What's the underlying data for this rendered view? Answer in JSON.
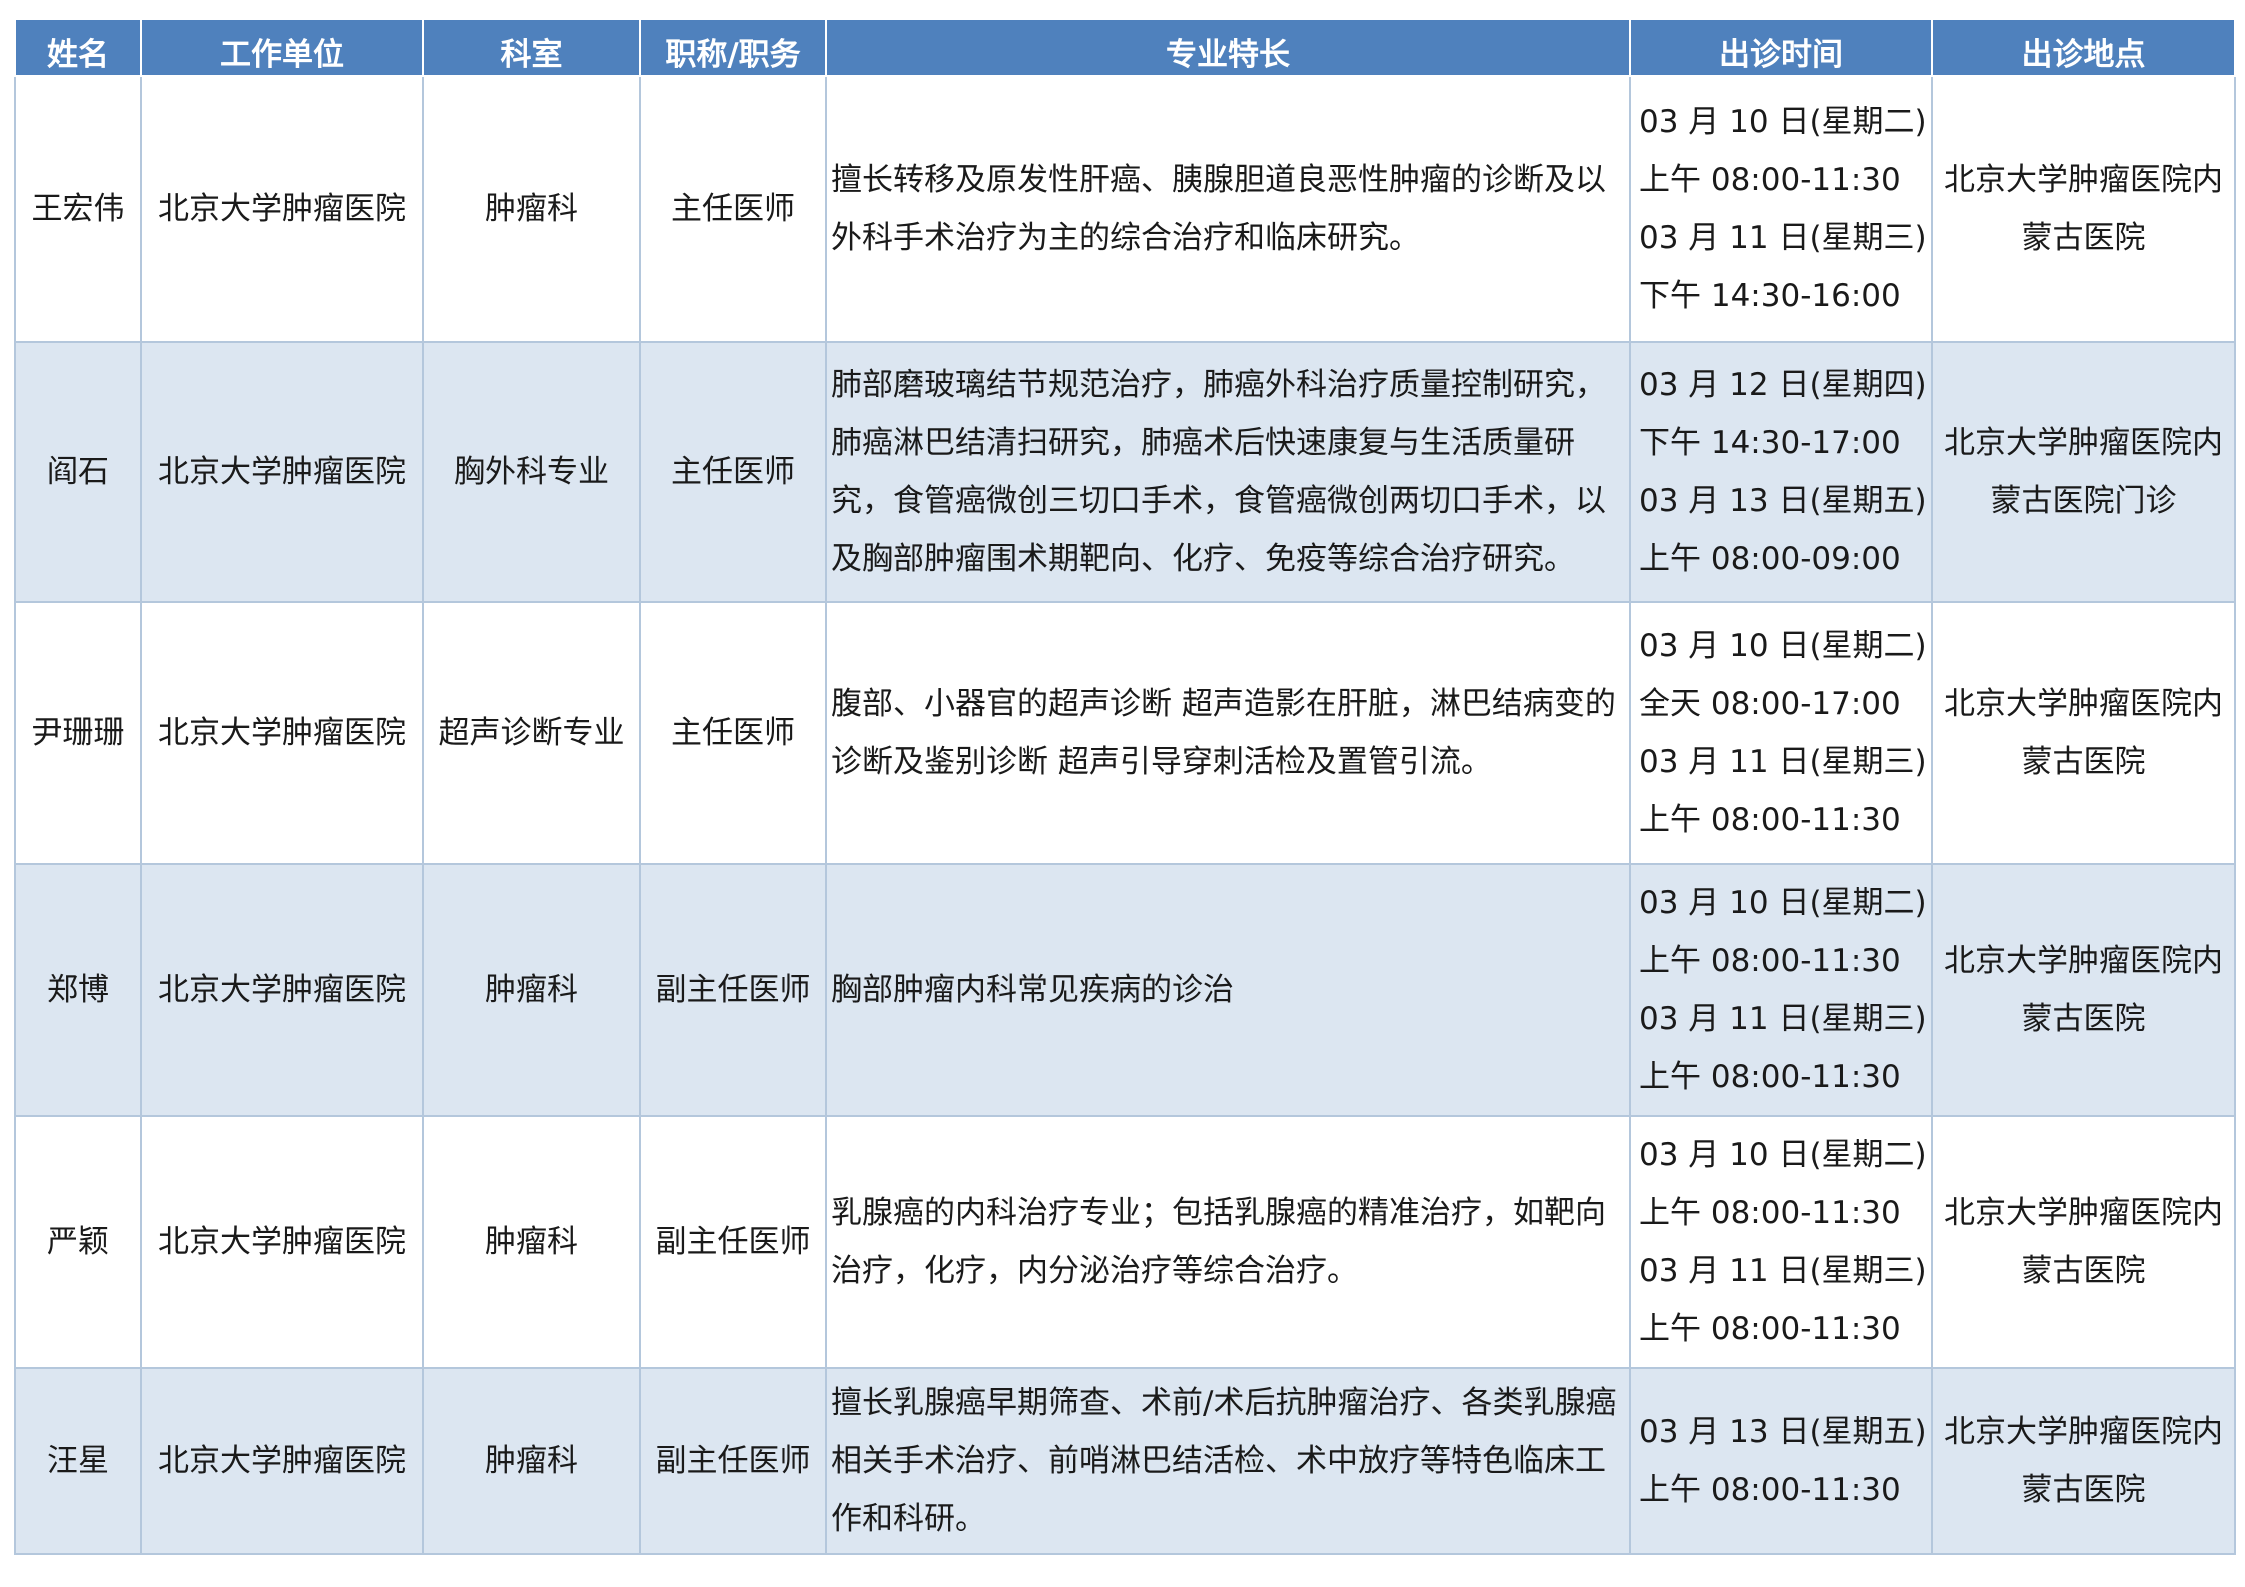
{
  "table": {
    "headers": [
      "姓名",
      "工作单位",
      "科室",
      "职称/职务",
      "专业特长",
      "出诊时间",
      "出诊地点"
    ],
    "rows": [
      {
        "name": "王宏伟",
        "unit": "北京大学肿瘤医院",
        "dept": "肿瘤科",
        "title": "主任医师",
        "specialty": "擅长转移及原发性肝癌、胰腺胆道良恶性肿瘤的诊断及以外科手术治疗为主的综合治疗和临床研究。",
        "time": [
          "03 月 10 日(星期二)",
          "上午 08:00-11:30",
          "03 月 11 日(星期三)",
          "下午 14:30-16:00"
        ],
        "location": [
          "北京大学肿瘤医院内",
          "蒙古医院"
        ]
      },
      {
        "name": "阎石",
        "unit": "北京大学肿瘤医院",
        "dept": "胸外科专业",
        "title": "主任医师",
        "specialty": "肺部磨玻璃结节规范治疗，肺癌外科治疗质量控制研究，肺癌淋巴结清扫研究，肺癌术后快速康复与生活质量研究，食管癌微创三切口手术，食管癌微创两切口手术，以及胸部肿瘤围术期靶向、化疗、免疫等综合治疗研究。",
        "time": [
          "03 月 12 日(星期四)",
          "下午 14:30-17:00",
          "03 月 13 日(星期五)",
          "上午 08:00-09:00"
        ],
        "location": [
          "北京大学肿瘤医院内",
          "蒙古医院门诊"
        ]
      },
      {
        "name": "尹珊珊",
        "unit": "北京大学肿瘤医院",
        "dept": "超声诊断专业",
        "title": "主任医师",
        "specialty": "腹部、小器官的超声诊断 超声造影在肝脏，淋巴结病变的诊断及鉴别诊断 超声引导穿刺活检及置管引流。",
        "time": [
          "03 月 10 日(星期二)",
          "全天 08:00-17:00",
          "03 月 11 日(星期三)",
          "上午 08:00-11:30"
        ],
        "location": [
          "北京大学肿瘤医院内",
          "蒙古医院"
        ]
      },
      {
        "name": "郑博",
        "unit": "北京大学肿瘤医院",
        "dept": "肿瘤科",
        "title": "副主任医师",
        "specialty": "胸部肿瘤内科常见疾病的诊治",
        "time": [
          "03 月 10 日(星期二)",
          "上午 08:00-11:30",
          "03 月 11 日(星期三)",
          "上午 08:00-11:30"
        ],
        "location": [
          "北京大学肿瘤医院内",
          "蒙古医院"
        ]
      },
      {
        "name": "严颖",
        "unit": "北京大学肿瘤医院",
        "dept": "肿瘤科",
        "title": "副主任医师",
        "specialty": "乳腺癌的内科治疗专业；包括乳腺癌的精准治疗，如靶向治疗，化疗，内分泌治疗等综合治疗。",
        "time": [
          "03 月 10 日(星期二)",
          "上午 08:00-11:30",
          "03 月 11 日(星期三)",
          "上午 08:00-11:30"
        ],
        "location": [
          "北京大学肿瘤医院内",
          "蒙古医院"
        ]
      },
      {
        "name": "汪星",
        "unit": "北京大学肿瘤医院",
        "dept": "肿瘤科",
        "title": "副主任医师",
        "specialty": "擅长乳腺癌早期筛查、术前/术后抗肿瘤治疗、各类乳腺癌相关手术治疗、前哨淋巴结活检、术中放疗等特色临床工作和科研。",
        "time": [
          "03 月 13 日(星期五)",
          "上午 08:00-11:30"
        ],
        "location": [
          "北京大学肿瘤医院内",
          "蒙古医院"
        ]
      }
    ]
  },
  "colors": {
    "header_bg": "#4f81bd",
    "header_text": "#ffffff",
    "band_bg": "#dce6f1",
    "border": "#b4c7dc"
  }
}
